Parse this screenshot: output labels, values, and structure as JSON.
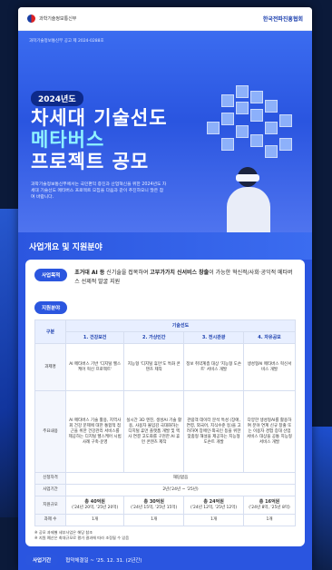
{
  "header": {
    "gov_label": "과학기술정보통신부",
    "assoc_label": "한국전파진흥협회"
  },
  "hero": {
    "notice": "과학기술정보통신부 공고 제 2024-0288호",
    "year_badge": "2024년도",
    "title_line1": "차세대 기술선도",
    "title_line2": "메타버스",
    "title_line3": "프로젝트 공모",
    "desc": "과학기술정보통신부에서는 국민편익 증진과 산업혁신을 위한 2024년도 차세대 기술선도 메타버스 프로젝트 모집을 다음과 같이 추진하오니 많은 참여 바랍니다."
  },
  "section": {
    "title": "사업개요 및 지원분야"
  },
  "purpose": {
    "pill": "사업목적",
    "text_bold1": "초거대 AI 등",
    "text1": " 신기술을 접목하여 ",
    "text_bold2": "고부가가치 신서비스 창출",
    "text2": "이 가능한 혁신적/사회·공익적 메타버스 선제적 발굴 지원"
  },
  "support": {
    "pill": "지원분야"
  },
  "table": {
    "header_group": "구분",
    "header_tech": "기술선도",
    "columns": [
      "1. 건강보건",
      "2. 가상인간",
      "3. 전시관광",
      "4. 자유공모"
    ],
    "rows": [
      {
        "label": "과제명",
        "cells": [
          "AI 메타버스 기반 '디지털 헬스케어 혁신 프로젝트'",
          "지능형 '디지털 휴먼'도 특화 콘텐츠 제작",
          "정보 취약계층 대상 '지능형 도슨트' 서비스 개발",
          "생성형AI 메타버스 혁신서비스 개발"
        ]
      },
      {
        "label": "주요내용",
        "cells": [
          "AI 메타버스 기술 활용, 지역사회 건강 문제에 대한 통합적 접근을 위한 건강관리 서비스를 제공하는 디지털 헬스케어 시범사례 구축·운영",
          "실시간 3D 엔진, 생성AI 기술 활용, 사용자 몰입감 극대화하는 디지털 휴먼 플랫폼 개발 및 엑사 연결 고도화를 구현한 AI 휴먼 콘텐츠 제작",
          "관람객 데이터 분석 특성 (장애, 연령, 외국어, 지식수준 등)을 고려하여 장애인·외국인 등을 위한 맞춤형 해설을 제공하는 지능형 도슨트 개발",
          "다양한 생성형AI를 활용하여 분야 연계 신규 창출 또는 이용자 경험 증대 산업 서비스 대상을 공통 지능형 서비스 개발"
        ]
      },
      {
        "label": "신청자격",
        "merged": "해당없음"
      },
      {
        "label": "사업기간",
        "merged": "2년('24년 ~ '25년)"
      },
      {
        "label": "지원규모",
        "cells": [
          {
            "main": "총 40억원",
            "sub": "('24년 20억, '25년 20억)"
          },
          {
            "main": "총 30억원",
            "sub": "('24년 15억, '25년 15억)"
          },
          {
            "main": "총 24억원",
            "sub": "('24년 12억, '25년 12억)"
          },
          {
            "main": "총 16억원",
            "sub": "('24년 8억, '25년 8억)"
          }
        ]
      },
      {
        "label": "과제 수",
        "cells": [
          "1개",
          "1개",
          "1개",
          "1개"
        ]
      }
    ]
  },
  "notes": [
    "※ 공모 과제별 세부사업은 해당 참조",
    "※ 지원 예산은 최대규모로 평가 결과에 따라 조정될 수 있음"
  ],
  "period": {
    "pill": "사업기간",
    "text": "협약체결일 ~ '25. 12. 31. (2년간)"
  }
}
